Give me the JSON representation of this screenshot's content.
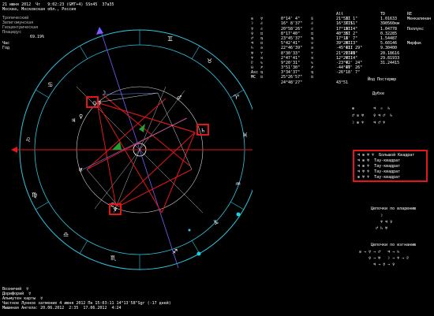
{
  "header": {
    "line1": "21 июня 2012  Чт   9:02:23 (GMT+4) SSn45  37a35",
    "line2": "Москва, Московская обл., Россия"
  },
  "left_info": {
    "lines": [
      "Тропический",
      "Зелигомунская",
      "Геоцентрическая",
      "Плацидус"
    ],
    "percent": "69.19%",
    "day_label": "Час",
    "year_label": "Год"
  },
  "table": {
    "header": [
      "",
      "",
      "",
      "Alt",
      "TD",
      "RE",
      "",
      "",
      "",
      ""
    ],
    "rows": [
      [
        "⊙",
        "☿",
        "",
        "0°14' 4\"",
        "♋",
        "21°53' 1\"",
        "XI",
        "1.01633",
        "Менкалинан"
      ],
      [
        "☽",
        "♌",
        "",
        "16° 8'37\"",
        "♌",
        "16°37'51\"",
        "XII",
        "390560км",
        ""
      ],
      [
        "☿",
        "♌",
        "",
        "20°58'26\"",
        "♌",
        "17°19' 4\"",
        "XII",
        "1.04778",
        "Поллукс"
      ],
      [
        "♀",
        "♊",
        "",
        "8°17'40\"",
        "♊",
        "40°35' 2\"",
        "XI",
        "0.32285",
        ""
      ],
      [
        "♂",
        "♍",
        "",
        "23°45'37\"",
        "♍",
        "17°18' 7\"",
        "I",
        "1.54487",
        ""
      ],
      [
        "♃",
        "♊",
        "",
        "5°42'41\"",
        "♉",
        "39°20' 3\"",
        "XII",
        "5.60146",
        "Мирфак"
      ],
      [
        "♄",
        "♎",
        "",
        "22°46'39\"",
        "♎",
        "-45°41' 29\"",
        "III",
        "9.30400",
        ""
      ],
      [
        "♅",
        "♈",
        "",
        "8°30'33\"",
        "♈",
        "21°21'49\"",
        "VIII",
        "20.18616",
        ""
      ],
      [
        "♆",
        "♓",
        "",
        "2°47'41\"",
        "♓",
        "12°24' 4\"",
        "VII",
        "29.81933",
        ""
      ],
      [
        "♇",
        "♑",
        "",
        "9°20'31\"",
        "♑",
        "-23°42' 24\"",
        "V",
        "31.24415",
        ""
      ],
      [
        "☊",
        "♐",
        "",
        "3°51'30\"",
        "♐",
        "-44°47' 26\"",
        "IV",
        "",
        ""
      ],
      [
        "Asc",
        "♍",
        "",
        "3°34'37\"",
        "♍",
        "-26°18' 7\"",
        "",
        "",
        ""
      ],
      [
        "MC",
        "♊",
        "",
        "25°26'57\"",
        "♊",
        "",
        "",
        "",
        ""
      ],
      [
        "",
        "",
        "",
        "24°48'27\"",
        "",
        "43°51",
        "",
        "",
        ""
      ]
    ]
  },
  "right_labels": {
    "fixed_star": "Йод Постерюр",
    "dubhe": "Дубхе"
  },
  "aspects_box": {
    "title": "Большой Квадрат",
    "lines": [
      "♃ ⊗ ♅ ♆  Большой Квадрат",
      "♃ ⊗ ♅  Тау-квадрат",
      "♃ ⊗ ♆  Тау-квадрат",
      "♃ ♅ ♆  Тау-квадрат",
      "⊗ ♅ ♆  Тау-квадрат"
    ]
  },
  "chains": {
    "ownership_title": "Цепочки по владению",
    "exaltation_title": "Цепочки по изгнанию"
  },
  "bottom_info": {
    "lines": [
      "Возничий  ☿",
      "Дорифорий  ☿",
      "Альмутен карты  ☿",
      "Частное Лунное затмение 4 июня 2012 Пн 15:03:11 14°13'58\"Sgr (-17 дней)",
      "Мышиная Ангела: 20.06.2012  2:35  17.06.2012  4:24"
    ]
  },
  "colors": {
    "background": "#000000",
    "circle": "#2ec6e0",
    "aspect_red": "#e3161b",
    "aspect_green": "#22a034",
    "highlight": "#e3161b"
  }
}
